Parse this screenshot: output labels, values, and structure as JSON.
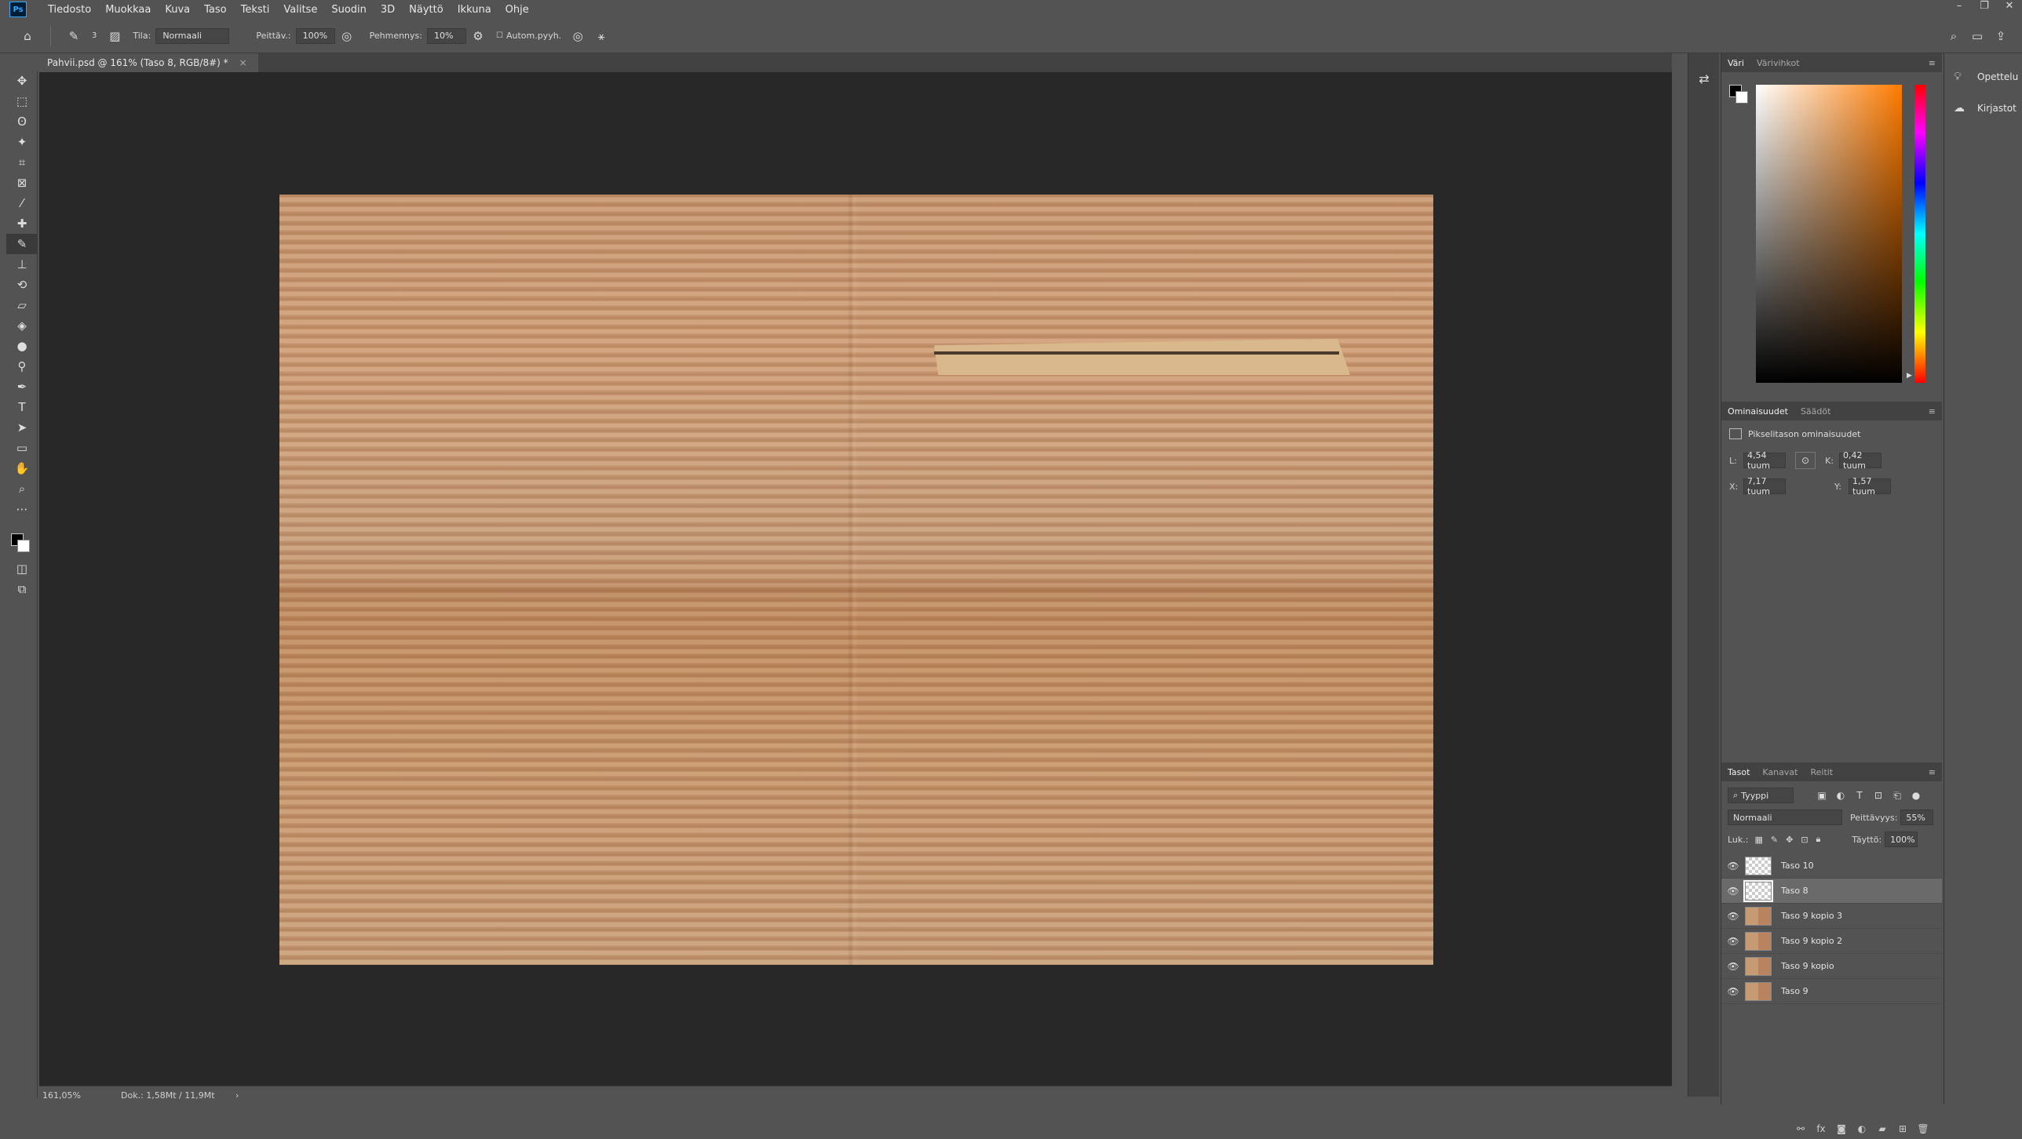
{
  "app": {
    "logo": "Ps"
  },
  "menu": [
    "Tiedosto",
    "Muokkaa",
    "Kuva",
    "Taso",
    "Teksti",
    "Valitse",
    "Suodin",
    "3D",
    "Näyttö",
    "Ikkuna",
    "Ohje"
  ],
  "window_controls": {
    "minimize": "–",
    "restore": "❐",
    "close": "✕"
  },
  "options": {
    "brush_size": "3",
    "mode_label": "Tila:",
    "mode_value": "Normaali",
    "opacity_label": "Peittäv.:",
    "opacity_value": "100%",
    "flow_label": "Pehmennys:",
    "flow_value": "10%",
    "auto_label": "Autom.pyyh."
  },
  "document": {
    "tab_title": "Pahvii.psd @ 161% (Taso 8, RGB/8#) *",
    "close": "×"
  },
  "status": {
    "zoom": "161,05%",
    "doc_size": "Dok.: 1,58Mt / 11,9Mt",
    "arrow": "›"
  },
  "color_panel": {
    "tabs": [
      "Väri",
      "Värivihkot"
    ],
    "active_tab": "Väri"
  },
  "properties_panel": {
    "tabs": [
      "Ominaisuudet",
      "Säädöt"
    ],
    "active_tab": "Ominaisuudet",
    "subtitle": "Pikselitason ominaisuudet",
    "w_label": "L:",
    "w_value": "4,54 tuum",
    "h_label": "K:",
    "h_value": "0,42 tuum",
    "x_label": "X:",
    "x_value": "7,17 tuum",
    "y_label": "Y:",
    "y_value": "1,57 tuum",
    "link": "⊙"
  },
  "layers_panel": {
    "tabs": [
      "Tasot",
      "Kanavat",
      "Reitit"
    ],
    "active_tab": "Tasot",
    "filter": "Tyyppi",
    "blend_mode": "Normaali",
    "opacity_label": "Peittävyys:",
    "opacity_value": "55%",
    "lock_label": "Luk.:",
    "fill_label": "Täyttö:",
    "fill_value": "100%",
    "layers": [
      {
        "name": "Taso 10",
        "selected": false
      },
      {
        "name": "Taso 8",
        "selected": true
      },
      {
        "name": "Taso 9 kopio 3",
        "selected": false
      },
      {
        "name": "Taso 9 kopio 2",
        "selected": false
      },
      {
        "name": "Taso 9 kopio",
        "selected": false
      },
      {
        "name": "Taso 9",
        "selected": false
      }
    ]
  },
  "right_col": {
    "learn": "Opettelu",
    "libraries": "Kirjastot"
  },
  "tools": [
    "move-tool",
    "marquee-tool",
    "lasso-tool",
    "magic-wand-tool",
    "crop-tool",
    "frame-tool",
    "eyedropper-tool",
    "healing-brush-tool",
    "brush-tool",
    "clone-stamp-tool",
    "history-brush-tool",
    "eraser-tool",
    "paint-bucket-tool",
    "blur-tool",
    "dodge-tool",
    "pen-tool",
    "type-tool",
    "path-selection-tool",
    "rectangle-tool",
    "hand-tool",
    "zoom-tool",
    "more-tools"
  ],
  "active_tool": "brush-tool"
}
